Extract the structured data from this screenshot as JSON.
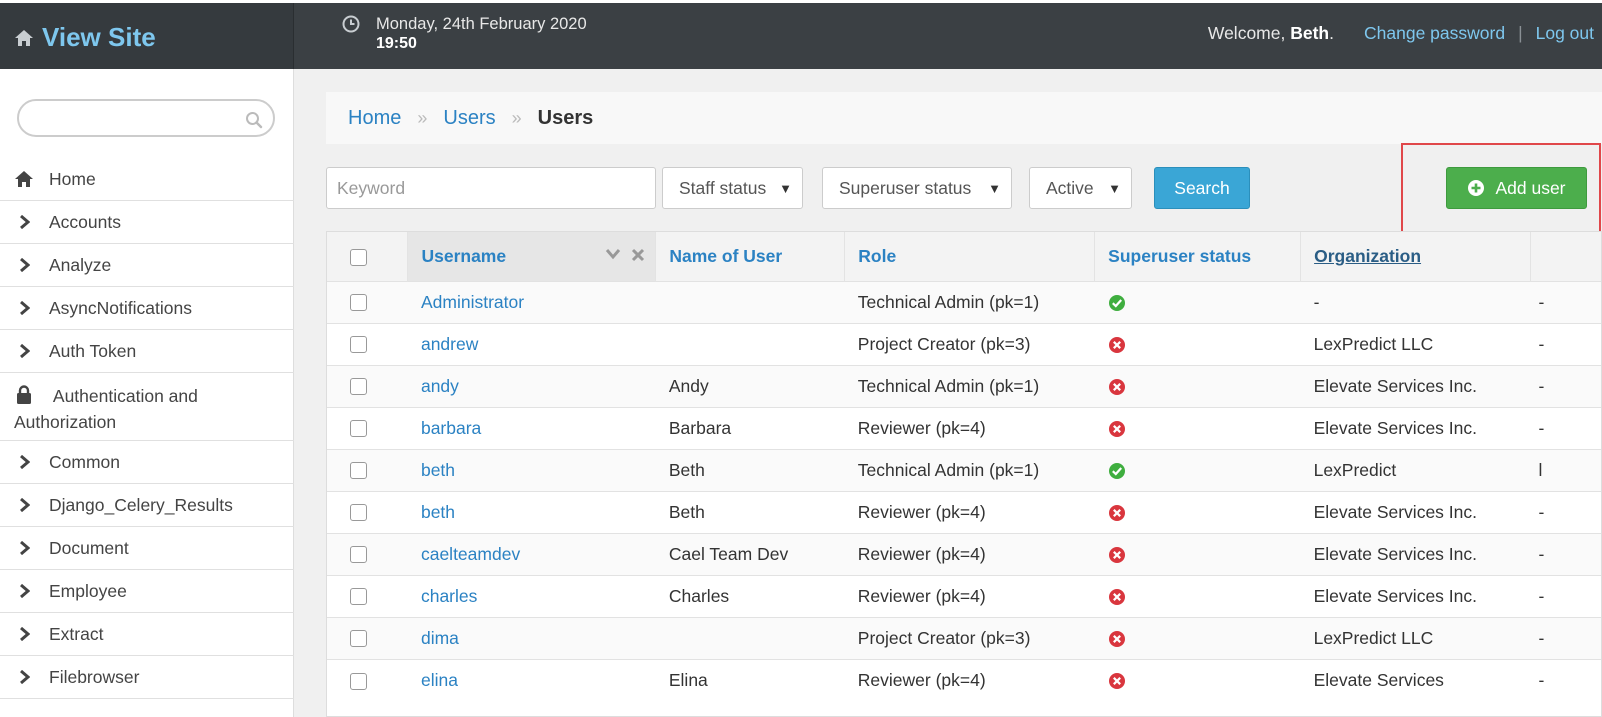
{
  "header": {
    "brand": "View Site",
    "date": "Monday, 24th February 2020",
    "time": "19:50",
    "welcome_prefix": "Welcome,",
    "user_name": "Beth",
    "welcome_suffix": ".",
    "change_password": "Change password",
    "separator": "|",
    "logout": "Log out"
  },
  "sidebar": {
    "search_placeholder": "",
    "items": [
      {
        "label": "Home",
        "icon": "home-icon"
      },
      {
        "label": "Accounts",
        "icon": "chevron-right-icon"
      },
      {
        "label": "Analyze",
        "icon": "chevron-right-icon"
      },
      {
        "label": "AsyncNotifications",
        "icon": "chevron-right-icon"
      },
      {
        "label": "Auth Token",
        "icon": "chevron-right-icon"
      },
      {
        "label": "Authentication and Authorization",
        "icon": "lock-icon"
      },
      {
        "label": "Common",
        "icon": "chevron-right-icon"
      },
      {
        "label": "Django_Celery_Results",
        "icon": "chevron-right-icon"
      },
      {
        "label": "Document",
        "icon": "chevron-right-icon"
      },
      {
        "label": "Employee",
        "icon": "chevron-right-icon"
      },
      {
        "label": "Extract",
        "icon": "chevron-right-icon"
      },
      {
        "label": "Filebrowser",
        "icon": "chevron-right-icon"
      }
    ]
  },
  "breadcrumb": {
    "items": [
      "Home",
      "Users",
      "Users"
    ],
    "separator": "»"
  },
  "filters": {
    "keyword_placeholder": "Keyword",
    "staff_status": "Staff status",
    "superuser_status": "Superuser status",
    "active": "Active",
    "search_label": "Search",
    "add_user_label": "Add user"
  },
  "table": {
    "columns": [
      "Username",
      "Name of User",
      "Role",
      "Superuser status",
      "Organization"
    ],
    "rows": [
      {
        "username": "Administrator",
        "name": "",
        "role": "Technical Admin (pk=1)",
        "superuser": true,
        "org": "-",
        "extra": "-"
      },
      {
        "username": "andrew",
        "name": "",
        "role": "Project Creator (pk=3)",
        "superuser": false,
        "org": "LexPredict LLC",
        "extra": "-"
      },
      {
        "username": "andy",
        "name": "Andy",
        "role": "Technical Admin (pk=1)",
        "superuser": false,
        "org": "Elevate Services Inc.",
        "extra": "-"
      },
      {
        "username": "barbara",
        "name": "Barbara",
        "role": "Reviewer (pk=4)",
        "superuser": false,
        "org": "Elevate Services Inc.",
        "extra": "-"
      },
      {
        "username": "beth",
        "name": "Beth",
        "role": "Technical Admin (pk=1)",
        "superuser": true,
        "org": "LexPredict",
        "extra": "l"
      },
      {
        "username": "beth",
        "name": "Beth",
        "role": "Reviewer (pk=4)",
        "superuser": false,
        "org": "Elevate Services Inc.",
        "extra": "-"
      },
      {
        "username": "caelteamdev",
        "name": "Cael Team Dev",
        "role": "Reviewer (pk=4)",
        "superuser": false,
        "org": "Elevate Services Inc.",
        "extra": "-"
      },
      {
        "username": "charles",
        "name": "Charles",
        "role": "Reviewer (pk=4)",
        "superuser": false,
        "org": "Elevate Services Inc.",
        "extra": "-"
      },
      {
        "username": "dima",
        "name": "",
        "role": "Project Creator (pk=3)",
        "superuser": false,
        "org": "LexPredict LLC",
        "extra": "-"
      },
      {
        "username": "elina",
        "name": "Elina",
        "role": "Reviewer (pk=4)",
        "superuser": false,
        "org": "Elevate Services",
        "extra": "-"
      }
    ]
  },
  "colors": {
    "header_bg": "#3b4044",
    "link": "#2b82c3",
    "brand": "#7ec7ee",
    "add_button": "#4cae4c",
    "search_button": "#3aa6d6",
    "yes": "#3fae3f",
    "no": "#d9363e",
    "highlight": "#e0474a"
  }
}
